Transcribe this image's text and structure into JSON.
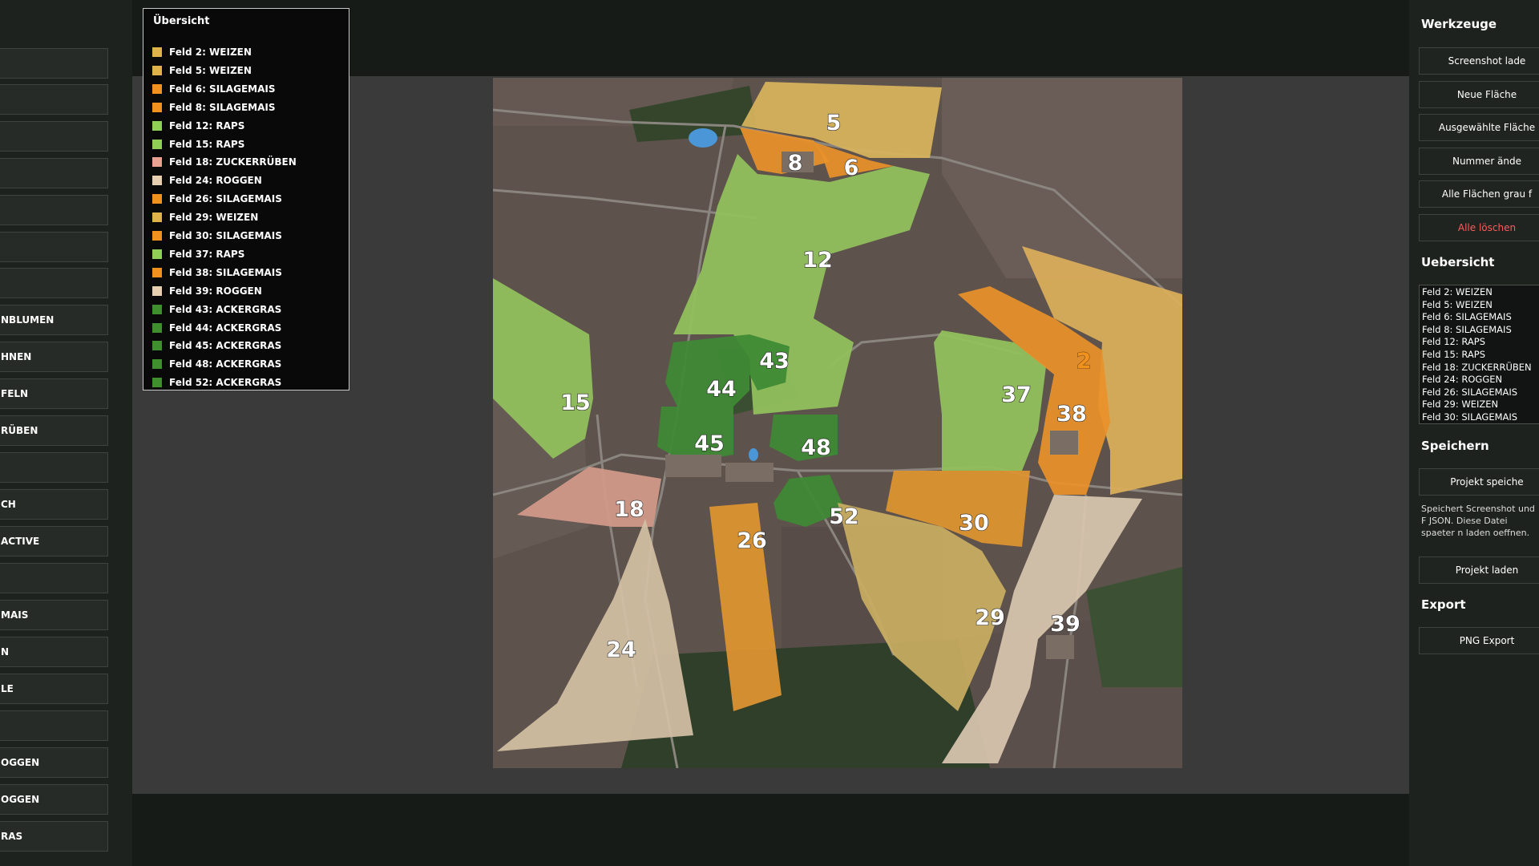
{
  "left_panel": {
    "buttons": [
      "",
      "",
      "",
      "",
      "",
      "",
      "",
      "NBLUMEN",
      "HNEN",
      "FELN",
      "RÜBEN",
      "",
      "CH",
      "ACTIVE",
      "",
      "MAIS",
      "N",
      "LE",
      "",
      "OGGEN",
      "OGGEN",
      "RAS"
    ]
  },
  "legend": {
    "title": "Übersicht",
    "items": [
      {
        "label": "Feld 2: WEIZEN",
        "color": "#e0b34a"
      },
      {
        "label": "Feld 5: WEIZEN",
        "color": "#e0b34a"
      },
      {
        "label": "Feld 6: SILAGEMAIS",
        "color": "#f2921e"
      },
      {
        "label": "Feld 8: SILAGEMAIS",
        "color": "#f2921e"
      },
      {
        "label": "Feld 12: RAPS",
        "color": "#8fcf55"
      },
      {
        "label": "Feld 15: RAPS",
        "color": "#8fcf55"
      },
      {
        "label": "Feld 18: ZUCKERRÜBEN",
        "color": "#e8a090"
      },
      {
        "label": "Feld 24: ROGGEN",
        "color": "#e6cfb0"
      },
      {
        "label": "Feld 26: SILAGEMAIS",
        "color": "#f2921e"
      },
      {
        "label": "Feld 29: WEIZEN",
        "color": "#e0b34a"
      },
      {
        "label": "Feld 30: SILAGEMAIS",
        "color": "#f2921e"
      },
      {
        "label": "Feld 37: RAPS",
        "color": "#8fcf55"
      },
      {
        "label": "Feld 38: SILAGEMAIS",
        "color": "#f2921e"
      },
      {
        "label": "Feld 39: ROGGEN",
        "color": "#e6cfb0"
      },
      {
        "label": "Feld 43: ACKERGRAS",
        "color": "#3f8f2f"
      },
      {
        "label": "Feld 44: ACKERGRAS",
        "color": "#3f8f2f"
      },
      {
        "label": "Feld 45: ACKERGRAS",
        "color": "#3f8f2f"
      },
      {
        "label": "Feld 48: ACKERGRAS",
        "color": "#3f8f2f"
      },
      {
        "label": "Feld 52: ACKERGRAS",
        "color": "#3f8f2f"
      }
    ]
  },
  "map": {
    "fields": [
      {
        "id": "2",
        "crop": "WEIZEN",
        "color": "#dcae5a"
      },
      {
        "id": "5",
        "crop": "WEIZEN",
        "color": "#d8b45c"
      },
      {
        "id": "6",
        "crop": "SILAGEMAIS",
        "color": "#e9912a"
      },
      {
        "id": "8",
        "crop": "SILAGEMAIS",
        "color": "#e9912a"
      },
      {
        "id": "12",
        "crop": "RAPS",
        "color": "#92c25c"
      },
      {
        "id": "15",
        "crop": "RAPS",
        "color": "#92c25c"
      },
      {
        "id": "18",
        "crop": "ZUCKERRÜBEN",
        "color": "#d39a8a"
      },
      {
        "id": "24",
        "crop": "ROGGEN",
        "color": "#d3c0a4"
      },
      {
        "id": "26",
        "crop": "SILAGEMAIS",
        "color": "#df9530"
      },
      {
        "id": "29",
        "crop": "WEIZEN",
        "color": "#c9ad62"
      },
      {
        "id": "30",
        "crop": "SILAGEMAIS",
        "color": "#df9530"
      },
      {
        "id": "37",
        "crop": "RAPS",
        "color": "#92c25c"
      },
      {
        "id": "38",
        "crop": "SILAGEMAIS",
        "color": "#e9912a"
      },
      {
        "id": "39",
        "crop": "ROGGEN",
        "color": "#d8c6ae"
      },
      {
        "id": "43",
        "crop": "ACKERGRAS",
        "color": "#3e8a35"
      },
      {
        "id": "44",
        "crop": "ACKERGRAS",
        "color": "#3e8a35"
      },
      {
        "id": "45",
        "crop": "ACKERGRAS",
        "color": "#3e8a35"
      },
      {
        "id": "48",
        "crop": "ACKERGRAS",
        "color": "#3e8a35"
      },
      {
        "id": "52",
        "crop": "ACKERGRAS",
        "color": "#3e8a35"
      }
    ]
  },
  "right_panel": {
    "tools_title": "Werkzeuge",
    "tool_buttons": [
      {
        "label": "Screenshot lade",
        "color": "#ffffff"
      },
      {
        "label": "Neue Fläche",
        "color": "#ffffff"
      },
      {
        "label": "Ausgewählte Fläche",
        "color": "#ffffff"
      },
      {
        "label": "Nummer ände",
        "color": "#ffffff"
      },
      {
        "label": "Alle Flächen grau f",
        "color": "#ffffff"
      },
      {
        "label": "Alle löschen",
        "color": "#ff5a5a"
      }
    ],
    "overview_title": "Uebersicht",
    "overview_items": [
      "Feld 2: WEIZEN",
      "Feld 5: WEIZEN",
      "Feld 6: SILAGEMAIS",
      "Feld 8: SILAGEMAIS",
      "Feld 12: RAPS",
      "Feld 15: RAPS",
      "Feld 18: ZUCKERRÜBEN",
      "Feld 24: ROGGEN",
      "Feld 26: SILAGEMAIS",
      "Feld 29: WEIZEN",
      "Feld 30: SILAGEMAIS"
    ],
    "save_title": "Speichern",
    "save_button": "Projekt speiche",
    "save_description": "Speichert Screenshot und F JSON. Diese Datei spaeter n laden oeffnen.",
    "load_button": "Projekt laden",
    "export_title": "Export",
    "png_button": "PNG Export"
  }
}
